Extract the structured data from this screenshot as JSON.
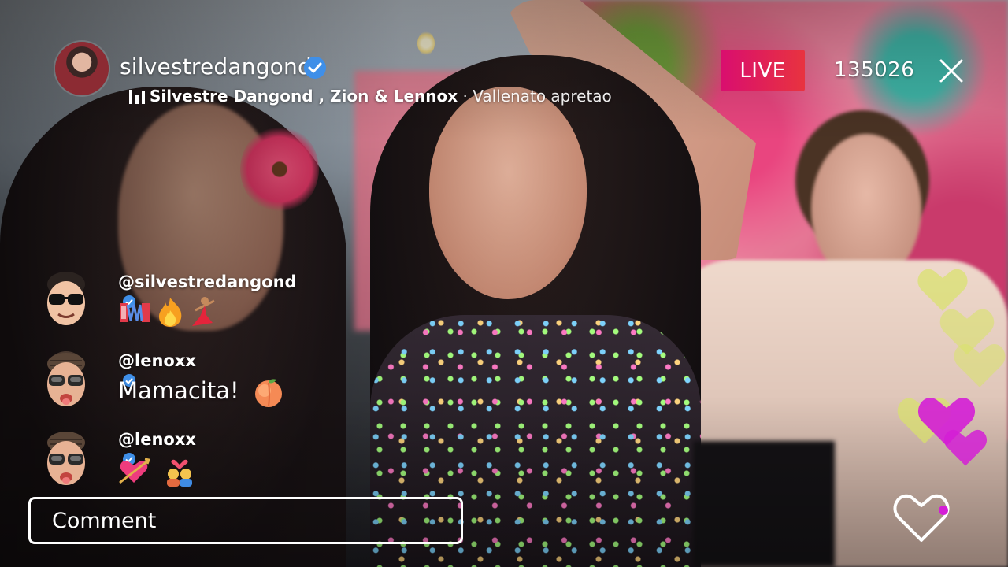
{
  "host": {
    "username": "silvestredangond",
    "verified": true
  },
  "music": {
    "artists": "Silvestre Dangond , Zion & Lennox",
    "separator": " · ",
    "song": "Vallenato apretao"
  },
  "live": {
    "badge_label": "LIVE",
    "viewer_count": "135026"
  },
  "comments": [
    {
      "username": "@silvestredangond",
      "verified": true,
      "text": "",
      "emojis": [
        "accordion-icon",
        "fire-icon",
        "dancer-icon"
      ]
    },
    {
      "username": "@lenoxx",
      "verified": true,
      "text": "Mamacita!",
      "emojis": [
        "peach-icon"
      ]
    },
    {
      "username": "@lenoxx",
      "verified": true,
      "text": "",
      "emojis": [
        "heart-arrow-icon",
        "couple-heart-icon"
      ]
    }
  ],
  "composer": {
    "placeholder": "Comment"
  },
  "colors": {
    "live_badge": "#e0184f",
    "verified": "#3f8fe8",
    "heart_magenta": "#d41ed6",
    "heart_yellow": "#d9e36a"
  }
}
